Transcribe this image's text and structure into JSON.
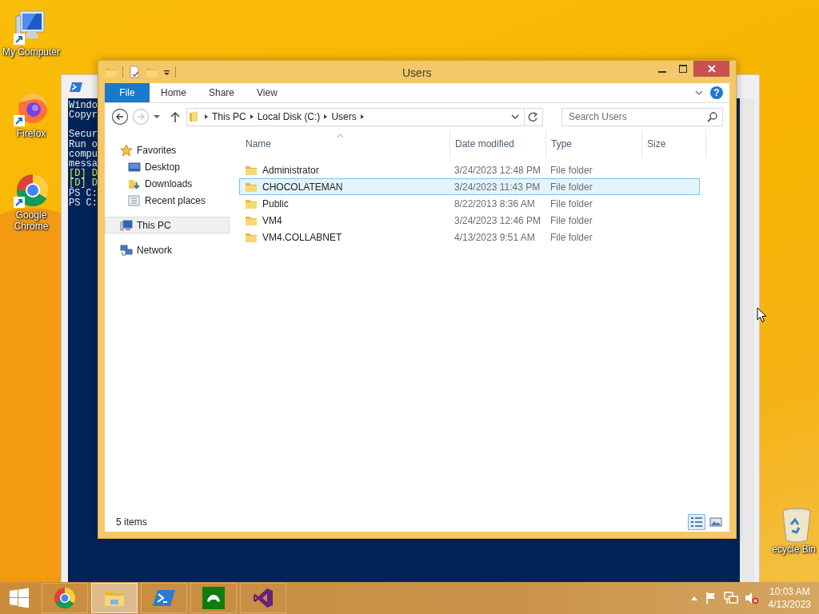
{
  "desktop_icons": [
    {
      "label": "My Computer",
      "kind": "computer"
    },
    {
      "label": "Firefox",
      "kind": "firefox"
    },
    {
      "label": "Google Chrome",
      "kind": "chrome"
    },
    {
      "label": "ecycle Bin",
      "kind": "recycle"
    }
  ],
  "console_window": {
    "lines": [
      {
        "text": "Windo",
        "kind": "output"
      },
      {
        "text": "Copyr",
        "kind": "output"
      },
      {
        "kind": "blank"
      },
      {
        "text": "Secur",
        "kind": "output"
      },
      {
        "text": "Run o",
        "kind": "output"
      },
      {
        "text": "compu",
        "kind": "output"
      },
      {
        "text": "messa",
        "kind": "output"
      },
      {
        "text": "[D] D",
        "kind": "choice"
      },
      {
        "text": "[D] D",
        "kind": "choice"
      },
      {
        "text": "PS C:",
        "kind": "output"
      },
      {
        "text": "PS C:",
        "kind": "output"
      }
    ]
  },
  "explorer": {
    "title": "Users",
    "ribbon_tabs": [
      {
        "label": "File",
        "kind": "file",
        "selected": true
      },
      {
        "label": "Home",
        "kind": "tab",
        "selected": false
      },
      {
        "label": "Share",
        "kind": "tab",
        "selected": false
      },
      {
        "label": "View",
        "kind": "tab",
        "selected": false
      }
    ],
    "help_label": "?",
    "breadcrumbs": [
      "This PC",
      "Local Disk (C:)",
      "Users"
    ],
    "search": {
      "placeholder": "Search Users"
    },
    "nav": [
      {
        "label": "Favorites",
        "kind": "star",
        "selected": false,
        "children": [
          {
            "label": "Desktop",
            "kind": "desktop",
            "selected": false
          },
          {
            "label": "Downloads",
            "kind": "downloads",
            "selected": false
          },
          {
            "label": "Recent places",
            "kind": "recent",
            "selected": false
          }
        ]
      },
      {
        "label": "This PC",
        "kind": "pc",
        "selected": true
      },
      {
        "label": "Network",
        "kind": "network",
        "selected": false
      }
    ],
    "columns": [
      "Name",
      "Date modified",
      "Type",
      "Size"
    ],
    "rows": [
      {
        "name": "Administrator",
        "date": "3/24/2023 12:48 PM",
        "type": "File folder",
        "selected": false
      },
      {
        "name": "CHOCOLATEMAN",
        "date": "3/24/2023 11:43 PM",
        "type": "File folder",
        "selected": true
      },
      {
        "name": "Public",
        "date": "8/22/2013 8:36 AM",
        "type": "File folder",
        "selected": false
      },
      {
        "name": "VM4",
        "date": "3/24/2023 12:46 PM",
        "type": "File folder",
        "selected": false
      },
      {
        "name": "VM4.COLLABNET",
        "date": "4/13/2023 9:51 AM",
        "type": "File folder",
        "selected": false
      }
    ],
    "status": "5 items",
    "view_buttons": [
      {
        "kind": "details",
        "selected": true
      },
      {
        "kind": "thumbnails",
        "selected": false
      }
    ]
  },
  "taskbar": {
    "apps": [
      {
        "kind": "chrome",
        "active": false
      },
      {
        "kind": "explorer",
        "active": true
      },
      {
        "kind": "powershell",
        "active": false
      },
      {
        "kind": "game",
        "active": false
      },
      {
        "kind": "studio",
        "active": false
      }
    ],
    "clock": {
      "time": "10:03 AM",
      "date": "4/13/2023"
    }
  }
}
